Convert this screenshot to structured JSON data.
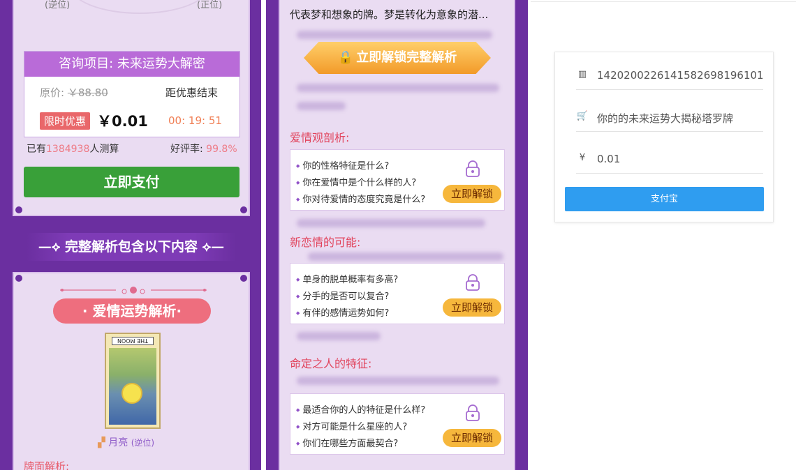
{
  "left": {
    "seal_left": "(逆位)",
    "seal_right": "(正位)",
    "consult_title": "咨询项目: 未来运势大解密",
    "original_price_label": "原价:",
    "original_price": "￥88.80",
    "discount_end_label": "距优惠结束",
    "sale_badge": "限时优惠",
    "sale_price": "￥0.01",
    "countdown": "00: 19: 51",
    "stats_prefix": "已有",
    "stats_count": "1384938",
    "stats_suffix": "人测算",
    "rating_label": "好评率:",
    "rating_value": "99.8%",
    "pay_button": "立即支付",
    "section_title": "完整解析包含以下内容",
    "love_banner": "· 爱情运势解析·",
    "card_label": "THE MOON",
    "card_name": "月亮",
    "card_orientation": "(逆位)",
    "face_text": "牌面解析:"
  },
  "mid": {
    "intro": "代表梦和想象的牌。梦是转化为意象的潜...",
    "unlock_full": "立即解锁完整解析",
    "sections": [
      {
        "title": "爱情观剖析:",
        "questions": [
          "你的性格特征是什么?",
          "你在爱情中是个什么样的人?",
          "你对待爱情的态度究竟是什么?"
        ],
        "button": "立即解锁"
      },
      {
        "title": "新恋情的可能:",
        "questions": [
          "单身的脱单概率有多高?",
          "分手的是否可以复合?",
          "有伴的感情运势如何?"
        ],
        "button": "立即解锁"
      },
      {
        "title": "命定之人的特征:",
        "questions": [
          "最适合你的人的特征是什么样?",
          "对方可能是什么星座的人?",
          "你们在哪些方面最契合?"
        ],
        "button": "立即解锁"
      }
    ]
  },
  "right": {
    "order_icon": "barcode-icon",
    "order_no": "14202002261415826981961​01",
    "product_icon": "cart-icon",
    "product": "你的的未来运势大揭秘塔罗牌",
    "amount_icon": "yuan-icon",
    "amount": "0.01",
    "pay_button": "支付宝"
  },
  "colors": {
    "purple": "#6b2fa0",
    "lavender": "#eadcf2",
    "green": "#39a039",
    "pink": "#ee6e7e",
    "orange": "#f6b73c",
    "blue": "#2f9df0"
  }
}
